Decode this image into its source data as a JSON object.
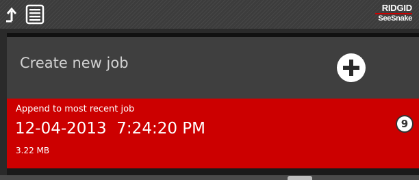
{
  "topbar": {
    "up_icon": "up-arrow-icon",
    "list_icon": "list-icon",
    "brand_top": "RIDGID",
    "brand_bottom": "SeeSnake"
  },
  "create_job": {
    "label": "Create new job",
    "icon": "plus-icon"
  },
  "recent_job": {
    "title": "Append to most recent job",
    "date": "12-04-2013",
    "time": "7:24:20 PM",
    "size": "3.22 MB",
    "count": "9"
  },
  "colors": {
    "accent_red": "#cc0000",
    "row_gray": "#3f3f3f",
    "topbar_gray": "#3c3c3c",
    "text_light": "#d2d2d2"
  }
}
